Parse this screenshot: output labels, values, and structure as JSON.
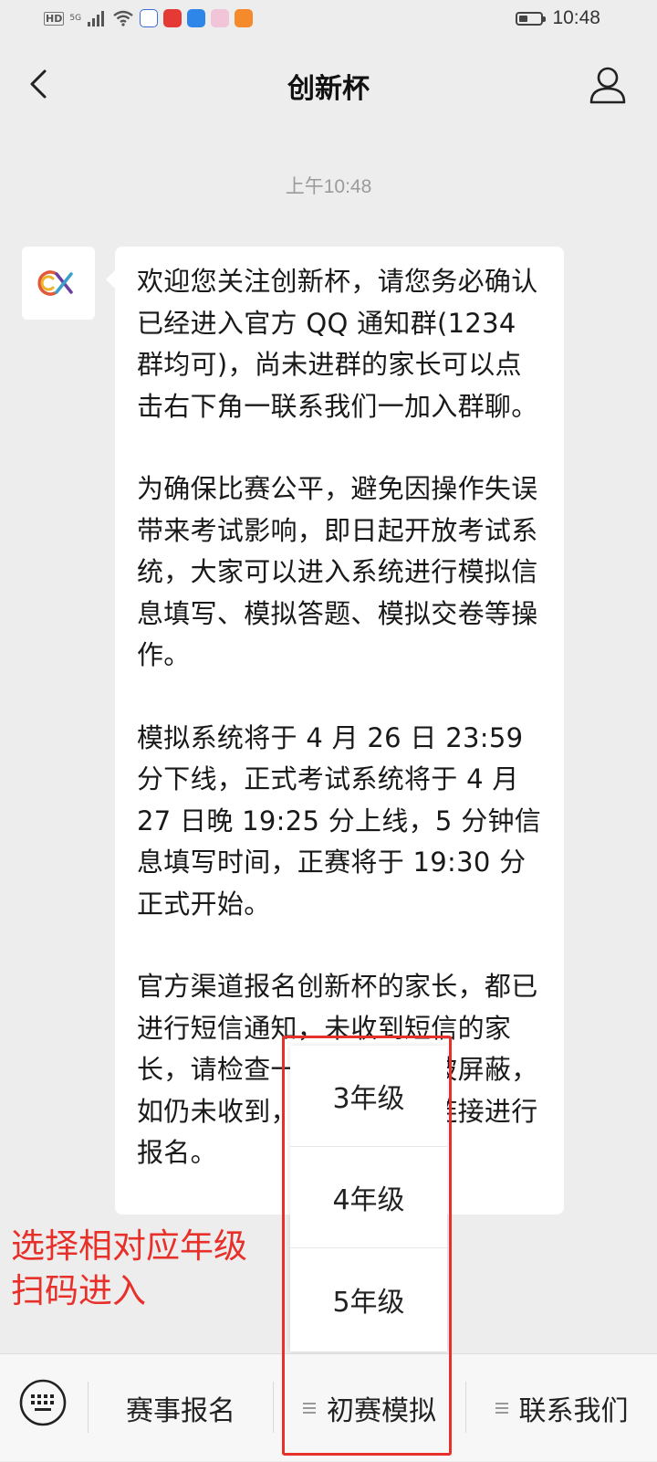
{
  "status_bar": {
    "hd": "HD",
    "network": "5G",
    "time": "10:48",
    "battery_level": 0.4
  },
  "nav": {
    "title": "创新杯"
  },
  "chat": {
    "timestamp": "上午10:48",
    "avatar_logo": "CX",
    "message_paragraphs": [
      "欢迎您关注创新杯，请您务必确认已经进入官方 QQ 通知群(1234 群均可)，尚未进群的家长可以点击右下角一联系我们一加入群聊。",
      "为确保比赛公平，避免因操作失误带来考试影响，即日起开放考试系统，大家可以进入系统进行模拟信息填写、模拟答题、模拟交卷等操作。",
      "模拟系统将于 4 月 26 日 23:59 分下线，正式考试系统将于 4 月 27 日晚 19:25 分上线，5 分钟信息填写时间，正赛将于 19:30 分正式开始。",
      "官方渠道报名创新杯的家长，都已进行短信通知，未收到短信的家长，请检查一下短信是否被屏蔽，如仍未收到，请在左下角链接进行报名。"
    ]
  },
  "popup_menu": {
    "items": [
      "3年级",
      "4年级",
      "5年级"
    ]
  },
  "annotation": {
    "line1": "选择相对应年级",
    "line2": "扫码进入"
  },
  "bottom_menu": {
    "items": [
      "赛事报名",
      "初赛模拟",
      "联系我们"
    ]
  },
  "colors": {
    "background": "#ededed",
    "annotation_red": "#e8302b"
  }
}
